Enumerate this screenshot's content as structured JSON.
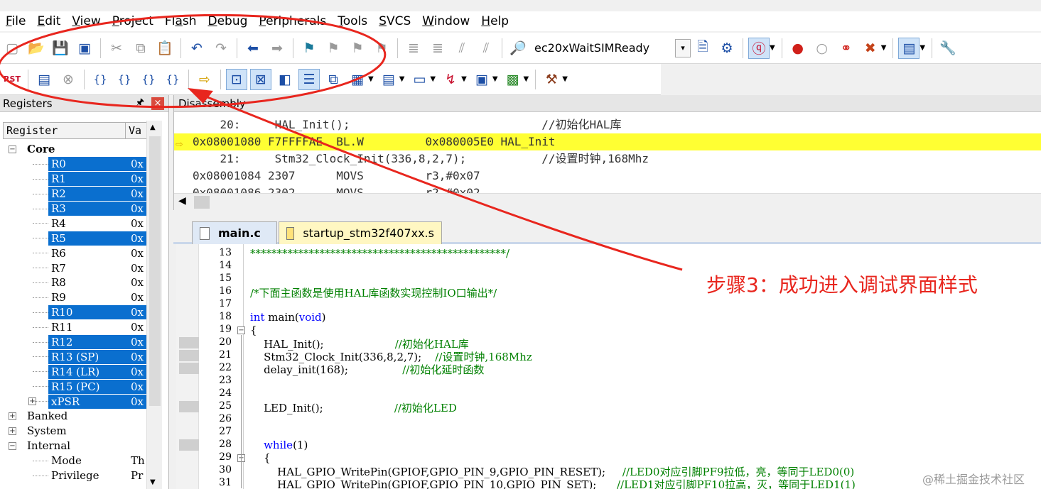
{
  "menu": [
    {
      "label": "File",
      "key": "F"
    },
    {
      "label": "Edit",
      "key": "E"
    },
    {
      "label": "View",
      "key": "V"
    },
    {
      "label": "Project",
      "key": "P"
    },
    {
      "label": "Flash",
      "key": "a"
    },
    {
      "label": "Debug",
      "key": "D"
    },
    {
      "label": "Peripherals",
      "key": "P"
    },
    {
      "label": "Tools",
      "key": "T"
    },
    {
      "label": "SVCS",
      "key": "S"
    },
    {
      "label": "Window",
      "key": "W"
    },
    {
      "label": "Help",
      "key": "H"
    }
  ],
  "toolbar": {
    "target": "ec20xWaitSIMReady",
    "rst_label": "RST"
  },
  "registers": {
    "title": "Registers",
    "col_register": "Register",
    "col_value": "Va",
    "rows": [
      {
        "name": "Core",
        "value": "",
        "level": 0,
        "expander": "−",
        "bold": true,
        "selected": false
      },
      {
        "name": "R0",
        "value": "0x",
        "level": 1,
        "selected": true
      },
      {
        "name": "R1",
        "value": "0x",
        "level": 1,
        "selected": true
      },
      {
        "name": "R2",
        "value": "0x",
        "level": 1,
        "selected": true
      },
      {
        "name": "R3",
        "value": "0x",
        "level": 1,
        "selected": true
      },
      {
        "name": "R4",
        "value": "0x",
        "level": 1,
        "selected": false
      },
      {
        "name": "R5",
        "value": "0x",
        "level": 1,
        "selected": true
      },
      {
        "name": "R6",
        "value": "0x",
        "level": 1,
        "selected": false
      },
      {
        "name": "R7",
        "value": "0x",
        "level": 1,
        "selected": false
      },
      {
        "name": "R8",
        "value": "0x",
        "level": 1,
        "selected": false
      },
      {
        "name": "R9",
        "value": "0x",
        "level": 1,
        "selected": false
      },
      {
        "name": "R10",
        "value": "0x",
        "level": 1,
        "selected": true
      },
      {
        "name": "R11",
        "value": "0x",
        "level": 1,
        "selected": false
      },
      {
        "name": "R12",
        "value": "0x",
        "level": 1,
        "selected": true
      },
      {
        "name": "R13 (SP)",
        "value": "0x",
        "level": 1,
        "selected": true
      },
      {
        "name": "R14 (LR)",
        "value": "0x",
        "level": 1,
        "selected": true
      },
      {
        "name": "R15 (PC)",
        "value": "0x",
        "level": 1,
        "selected": true
      },
      {
        "name": "xPSR",
        "value": "0x",
        "level": 1,
        "expander": "+",
        "selected": true
      },
      {
        "name": "Banked",
        "value": "",
        "level": 0,
        "expander": "+",
        "selected": false
      },
      {
        "name": "System",
        "value": "",
        "level": 0,
        "expander": "+",
        "selected": false
      },
      {
        "name": "Internal",
        "value": "",
        "level": 0,
        "expander": "−",
        "selected": false
      },
      {
        "name": "Mode",
        "value": "Th",
        "level": 1,
        "selected": false
      },
      {
        "name": "Privilege",
        "value": "Pr",
        "level": 1,
        "selected": false
      }
    ]
  },
  "disassembly": {
    "title": "Disassembly",
    "lines": [
      {
        "text": "    20:     HAL_Init();                            //初始化HAL库",
        "current": false
      },
      {
        "text": "0x08001080 F7FFFFAE  BL.W         0x080005E0 HAL_Init",
        "current": true
      },
      {
        "text": "    21:     Stm32_Clock_Init(336,8,2,7);           //设置时钟,168Mhz",
        "current": false
      },
      {
        "text": "0x08001084 2307      MOVS         r3,#0x07",
        "current": false
      },
      {
        "text": "0x08001086 2302      MOVS         r2,#0x02",
        "current": false
      }
    ]
  },
  "tabs": [
    {
      "label": "main.c",
      "active": true
    },
    {
      "label": "startup_stm32f407xx.s",
      "active": false
    }
  ],
  "code_lines": [
    {
      "n": "13",
      "text": "************************************************/",
      "type": "cm"
    },
    {
      "n": "14",
      "text": "",
      "type": "plain"
    },
    {
      "n": "15",
      "text": "",
      "type": "plain"
    },
    {
      "n": "16",
      "text": "/*下面主函数是使用HAL库函数实现控制IO口输出*/",
      "type": "cm"
    },
    {
      "n": "17",
      "text": "",
      "type": "plain"
    },
    {
      "n": "18",
      "text": "int main(void)",
      "type": "kwline"
    },
    {
      "n": "19",
      "text": "{",
      "type": "plain",
      "fold": "−"
    },
    {
      "n": "20",
      "text": "    HAL_Init();                     ",
      "comment": "//初始化HAL库",
      "type": "mixed"
    },
    {
      "n": "21",
      "text": "    Stm32_Clock_Init(336,8,2,7);    ",
      "comment": "//设置时钟,168Mhz",
      "type": "mixed"
    },
    {
      "n": "22",
      "text": "    delay_init(168);                ",
      "comment": "//初始化延时函数",
      "type": "mixed"
    },
    {
      "n": "23",
      "text": "",
      "type": "plain"
    },
    {
      "n": "24",
      "text": "",
      "type": "plain"
    },
    {
      "n": "25",
      "text": "    LED_Init();                     ",
      "comment": "//初始化LED",
      "type": "mixed"
    },
    {
      "n": "26",
      "text": "",
      "type": "plain"
    },
    {
      "n": "27",
      "text": "",
      "type": "plain"
    },
    {
      "n": "28",
      "text": "    while(1)",
      "type": "whileline"
    },
    {
      "n": "29",
      "text": "    {",
      "type": "plain",
      "fold": "−"
    },
    {
      "n": "30",
      "text": "        HAL_GPIO_WritePin(GPIOF,GPIO_PIN_9,GPIO_PIN_RESET);     ",
      "comment": "//LED0对应引脚PF9拉低，亮，等同于LED0(0)",
      "type": "mixed"
    },
    {
      "n": "31",
      "text": "        HAL_GPIO_WritePin(GPIOF,GPIO_PIN_10,GPIO_PIN_SET);      ",
      "comment": "//LED1对应引脚PF10拉高，灭，等同于LED1(1)",
      "type": "mixed"
    }
  ],
  "annotation": "步骤3：成功进入调试界面样式",
  "watermark": "@稀土掘金技术社区",
  "colors": {
    "annotation_red": "#e8261e",
    "selection_blue": "#0a6fcf",
    "current_line_yellow": "#ffff33",
    "comment_green": "#008000",
    "keyword_blue": "#0000ff"
  }
}
